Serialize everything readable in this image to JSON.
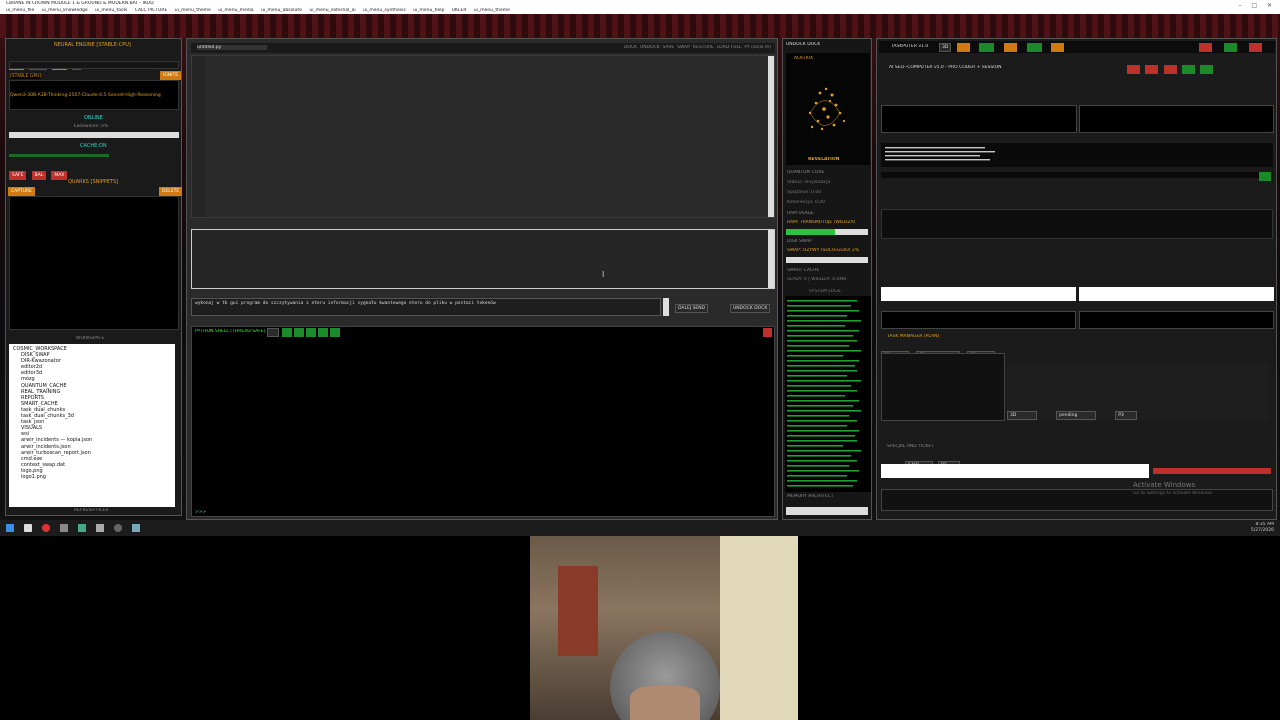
{
  "window": {
    "title": "CBRANE IN CROWN MODULE 1 & GROUND & MODERN.BAT - IKOD",
    "menus": [
      "ui_menu_file",
      "ui_menu_knowledge",
      "ui_menu_tools",
      "CALC PICTURE",
      "ui_menu_theme",
      "ui_menu_media",
      "ui_menu_absolute",
      "ui_menu_external_ai",
      "ui_menu_synthesis",
      "ui_menu_help",
      "UKLER",
      "ui_menu_theme"
    ]
  },
  "left": {
    "neural_title": "NEURAL ENGINE [STABLE-CPU]",
    "ctx_labels": [
      "CTX",
      "4096",
      "CPU",
      "0"
    ],
    "stable_gpu": "[STABLE GPU]",
    "ignite": "IGNITE",
    "model": "Qwen3-30B-A3B-Thinking-2507-Claude-4.5-Sonnet-High-Reasoning",
    "online": "ONLINE",
    "loading": "Ładowanie: 0%",
    "cache": "CACHE:ON",
    "modes": [
      "SAFE",
      "BAL",
      "MAX"
    ],
    "quarks_title": "QUARKS [SNIPPETS]",
    "capture": "CAPTURE",
    "delete": "DELETE",
    "workspace_title": "WORKSPACE",
    "tree": [
      "COSMIC_WORKSPACE",
      "DISK_SWAP",
      "DIR-Kwazonator",
      "editor2d",
      "editor3d",
      "mózg",
      "QUANTUM_CACHE",
      "REAL_TRAINING",
      "REPORTS",
      "SMART_CACHE",
      "task_dual_chunks",
      "task_dual_chunks_3d",
      "task_json",
      "VISUALS",
      "wsi",
      "arwir_incidents — kopia.json",
      "arwir_incidents.json",
      "arwir_turboscan_report.json",
      "cmd.exe",
      "context_swap.dat",
      "logo.png",
      "logo1.png"
    ],
    "refresh": "REFRESH FILES"
  },
  "center": {
    "tab": "untitled.py",
    "toolbar": [
      "DOCK",
      "UNDOCK",
      "SAVE",
      "SWAP",
      "RESTORE",
      "LOAD FULL",
      "PY (local.m)"
    ],
    "prompt": "wykonaj w tk gui program do szczytywania z eteru informacji sygnału kwantowego eteru do pliku w postaci tokenów",
    "send": "DALEJ SEND",
    "undock": "UNDOCK DOCK",
    "shell_title": "PYTHON SHELL [THREAD SAFE]",
    "shell_prompt": ">>>"
  },
  "mid": {
    "tabs": [
      "UNDOCK",
      "DOCK"
    ],
    "activation": "ACKTRIX",
    "revelation": "REVELATION",
    "quantum": "QUANTUM CORE",
    "status": "Status: inicjalizacja",
    "splatanie": "Splątanie: 0.00",
    "koherencja": "Koherencja: 0.00",
    "ram_title": "RAM USAGE",
    "ram_val": "RAM: TRANSMUTUJE (WIEDZA)",
    "disk_title": "DISK SWAP",
    "swap_val": "SWAP: OŻYWY (SOLFEGGIO) 2%",
    "smart_title": "SMART CACHE",
    "smart_val": "ŚLADY: 0 | WIEDZA: 0.0MB",
    "logs_title": "SYSTEM LOGS",
    "memory": "MEMORY ARCHITECT"
  },
  "right": {
    "title": "TASKPUTER v1.0",
    "subtitle": "AI SELF-COMPUTER v5.0 - PRO CODER + SESSION",
    "task_manager": "TASK MANAGER (PLAN)",
    "filters": [
      "All",
      "All",
      "All"
    ],
    "fields": [
      "3D",
      "pending",
      "P3"
    ],
    "special": "SPECJAL AND TICKET",
    "s1": "SAID",
    "s2": "P3",
    "activate_title": "Activate Windows",
    "activate_sub": "Go to Settings to activate Windows."
  },
  "taskbar": {
    "time": "8:35 AM",
    "date": "5/27/2026"
  }
}
